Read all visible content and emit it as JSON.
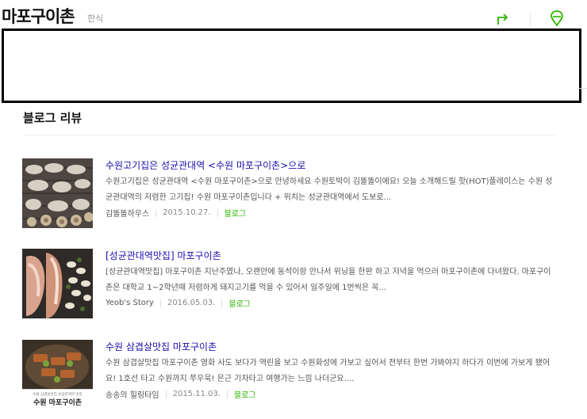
{
  "header": {
    "place_name": "마포구이촌",
    "category": "한식",
    "share_icon": "share-arrow-icon",
    "map_icon": "map-pin-icon"
  },
  "section": {
    "title": "블로그 리뷰"
  },
  "reviews": [
    {
      "title": "수원고기집은 성균관대역 <수원 마포구이촌>으로",
      "description": "수원고기집은 성균관대역 <수원 마포구이촌>으로 안녕하세요 수원토박이 김똘똘이에요! 오늘 소개해드릴 핫(HOT)플레이스는 수원 성균관대역의 저렴한 고기집! 수원 마포구이촌입니다 + 위치는 성균관대역에서 도보로...",
      "author": "김똘똘하우스",
      "date": "2015.10.27.",
      "source": "블로그"
    },
    {
      "title": "[성균관대역맛집] 마포구이촌",
      "description": "[성균관대역맛집] 마포구이촌 지난주였나, 오랜만에 동석이랑 만나서 위닝을 한판 하고 저녁을 먹으러 마포구이촌에 다녀왔다. 마포구이촌은 대학교 1~2학년때 저렴하게 돼지고기를 먹을 수 있어서 일주일에 1번씩은 꼭...",
      "author": "Yeob's Story",
      "date": "2016.05.03.",
      "source": "블로그"
    },
    {
      "title": "수원 삼겹살맛집 마포구이촌",
      "description": "수원 삼겹살맛집 마포구이촌 영화 사도 보다가 역린을 보고 수원화성에 가보고 싶어서 전부터 한번 가봐야지 하다가 이번에 가보게 됐어요! 1호선 타고 수원까지 쭈우욱! 은근 기차타고 여행가는 느낌 나더군요....",
      "author": "송송의 힐링타임",
      "date": "2015.11.03.",
      "source": "블로그",
      "thumb_caption": "수원 마포구이촌"
    }
  ],
  "colors": {
    "link": "#1a0dab",
    "source": "#2db400",
    "accent": "#2db400"
  }
}
